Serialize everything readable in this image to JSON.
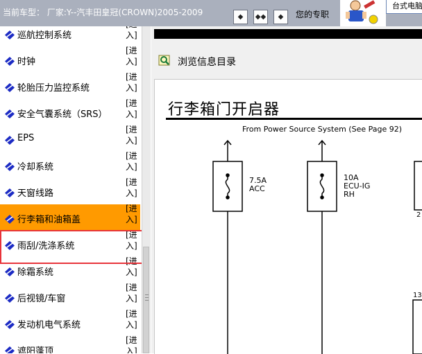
{
  "header": {
    "vehicle_text": "当前车型： 厂家:Y--汽丰田皇冠(CROWN)2005-2009",
    "nav_prev": "◆",
    "nav_both": "◆◆",
    "nav_next": "◆",
    "welcome": "您的专职",
    "logo_text": "台式电脑"
  },
  "sidebar": {
    "enter_label": "[进入]",
    "items": [
      {
        "label": "巡航控制系统"
      },
      {
        "label": "时钟"
      },
      {
        "label": "轮胎压力监控系统"
      },
      {
        "label": "安全气囊系统（SRS）"
      },
      {
        "label": "EPS"
      },
      {
        "label": "冷却系统"
      },
      {
        "label": "天窗线路"
      },
      {
        "label": "行李箱和油箱盖",
        "active": true
      },
      {
        "label": "雨刮/洗涤系统"
      },
      {
        "label": "除霜系统"
      },
      {
        "label": "后视镜/车窗"
      },
      {
        "label": "发动机电气系统"
      },
      {
        "label": "遮阳蓬顶"
      }
    ]
  },
  "content": {
    "browse_label": "浏览信息目录",
    "doc_title": "行李箱门开启器",
    "source_text": "From Power Source System (See Page 92)",
    "fuses": [
      {
        "amp": "7.5A",
        "name": "ACC",
        "extra": ""
      },
      {
        "amp": "10A",
        "name": "ECU-IG",
        "extra": "RH"
      }
    ],
    "edge_label_1": "2",
    "edge_label_2": "13"
  },
  "colors": {
    "topbar": "#aab0bd",
    "active_item": "#ff9a00",
    "selection_border": "#e8333a",
    "icon_blue": "#1c2bc4"
  }
}
